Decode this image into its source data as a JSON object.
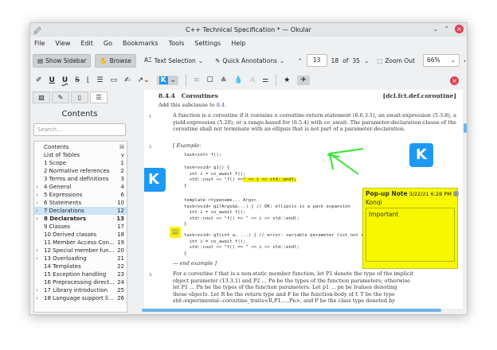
{
  "window": {
    "title": "C++ Technical Specification * — Okular"
  },
  "menu": [
    "File",
    "View",
    "Edit",
    "Go",
    "Bookmarks",
    "Tools",
    "Settings",
    "Help"
  ],
  "toolbar": {
    "show_sidebar": "Show Sidebar",
    "browse": "Browse",
    "text_selection": "Text Selection",
    "quick_annotations": "Quick Annotations",
    "page_current": "13",
    "page_label": "18",
    "of": "of",
    "page_total": "35",
    "zoom_out": "Zoom Out",
    "zoom_value": "66%"
  },
  "sidebar": {
    "title": "Contents",
    "search_placeholder": "Search...",
    "items": [
      {
        "label": "Contents",
        "page": "iii"
      },
      {
        "label": "List of Tables",
        "page": "v"
      },
      {
        "label": "1 Scope",
        "page": "1"
      },
      {
        "label": "2 Normative references",
        "page": "2"
      },
      {
        "label": "3 Terms and definitions",
        "page": "3"
      },
      {
        "label": "4 General",
        "page": "4",
        "expandable": true
      },
      {
        "label": "5 Expressions",
        "page": "6",
        "expandable": true
      },
      {
        "label": "6 Statements",
        "page": "10",
        "expandable": true
      },
      {
        "label": "7 Declarations",
        "page": "12",
        "expandable": true,
        "selected": true
      },
      {
        "label": "8 Declarators",
        "page": "13",
        "expandable": true,
        "bold": true
      },
      {
        "label": "9 Classes",
        "page": "17"
      },
      {
        "label": "10 Derived classes",
        "page": "18"
      },
      {
        "label": "11 Member Access Con...",
        "page": "19"
      },
      {
        "label": "12 Special member fun...",
        "page": "20",
        "expandable": true
      },
      {
        "label": "13 Overloading",
        "page": "21",
        "expandable": true
      },
      {
        "label": "14 Templates",
        "page": "22"
      },
      {
        "label": "15 Exception handling",
        "page": "23"
      },
      {
        "label": "16 Preprocessing direct...",
        "page": "24"
      },
      {
        "label": "17 Library introduction",
        "page": "25",
        "expandable": true
      },
      {
        "label": "18 Language support li...",
        "page": "26",
        "expandable": true
      }
    ]
  },
  "document": {
    "section_num": "8.4.4",
    "section_title": "Coroutines",
    "section_tag": "[dcl.fct.def.coroutine]",
    "add_text": "Add this subclause to",
    "add_link": "8.4.",
    "para1_num": "1",
    "para1": "A function is a coroutine if it contains a coroutine-return-statement (6.6.3.1), an await-expression (5.3.8), a yield-expression (5.20), or a range-based for (6.5.4) with co_await. The parameter-declaration-clause of the coroutine shall not terminate with an ellipsis that is not part of a parameter-declaration.",
    "para2_num": "2",
    "example": "[ Example:",
    "code1": "task<int> f();",
    "code2a": "task<void> g1() {\n  int i = co_await f();\n  std::cout << \"f() =>",
    "code2hl": "\" << i << std::endl;",
    "code2b": "}",
    "code3": "template <typename... Args>\ntask<void> g2(Args&&...) { // OK: ellipsis is a pack expansion\n  int i = co_await f();\n  std::cout << \"f() => \" << i << std::endl;\n}",
    "code4": "task<void> g3(int a, ...) { // error: variable parameter list not allowed\n  int i = co_await f();\n  std::cout << \"f() => \" << i << std::endl;\n}",
    "end_example": "— end example ]",
    "para3_num": "3",
    "para3_lines": [
      "For a coroutine f that is a non-static member function, let P1 denote the type of the implicit",
      "object parameter (13.3.1) and P2 ... Pn be the types of the function parameters; otherwise",
      "let P1 ... Pn be the types of the function parameters. Let p1 ... pn be lvalues denoting",
      "those objects. Let R be the return type and F be the function-body of f. T be the type",
      "std::experimental::coroutine_traits<R,P1,...,Pn>, and P be the class type denoted by"
    ]
  },
  "popup_note": {
    "title": "Pop-up Note",
    "date": "3/22/21 6:28 PM",
    "author": "Konqi",
    "text": "Important"
  },
  "colors": {
    "accent": "#1d99f3",
    "highlight": "#f7f300",
    "close": "#da4453",
    "freehand": "#2ee82e"
  }
}
